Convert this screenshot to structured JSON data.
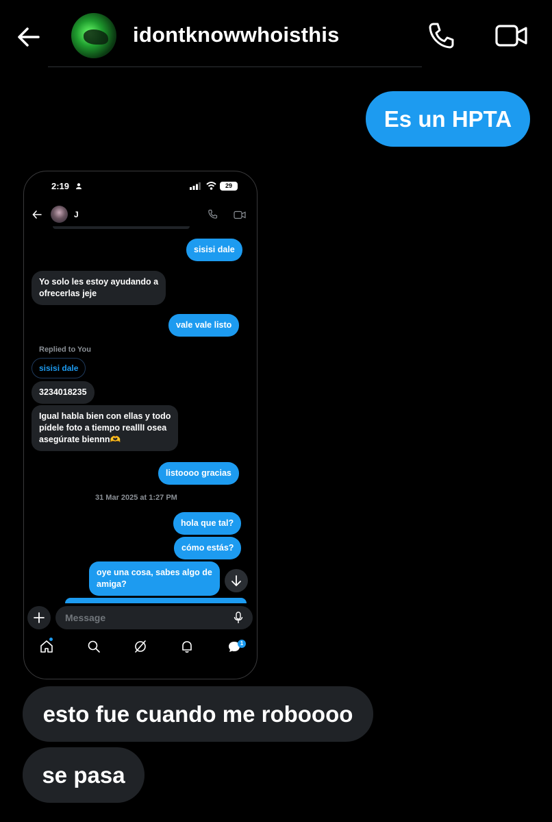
{
  "header": {
    "username": "idontknowwhoisthis"
  },
  "messages": {
    "out_1": "Es un HPTA",
    "in_1": "esto fue cuando me roboooo",
    "in_2": "se pasa"
  },
  "embedded_screenshot": {
    "status_time": "2:19",
    "battery": "29",
    "contact_name": "J",
    "bubbles": {
      "b1": "sisisi dale",
      "b2_line1": "Yo solo les estoy ayudando a",
      "b2_line2": "ofrecerlas jeje",
      "b3": "vale vale listo",
      "replied_label": "Replied to You",
      "reply_quote": "sisisi dale",
      "b4": "3234018235",
      "b5_line1": "Igual habla bien con ellas y todo",
      "b5_line2": "pídele foto a tiempo realllI osea",
      "b5_line3": "asegúrate biennn🫶",
      "b6": "listoooo gracias",
      "timestamp": "31 Mar 2025 at 1:27 PM",
      "b7": "hola que tal?",
      "b8": "cómo estás?",
      "b9_line1": "oye una cosa, sabes algo de",
      "b9_line2": "amiga?"
    },
    "composer_placeholder": "Message",
    "notification_count": "1"
  },
  "colors": {
    "accent": "#1d9bf0",
    "incoming_bubble": "#202327",
    "background": "#000000"
  }
}
